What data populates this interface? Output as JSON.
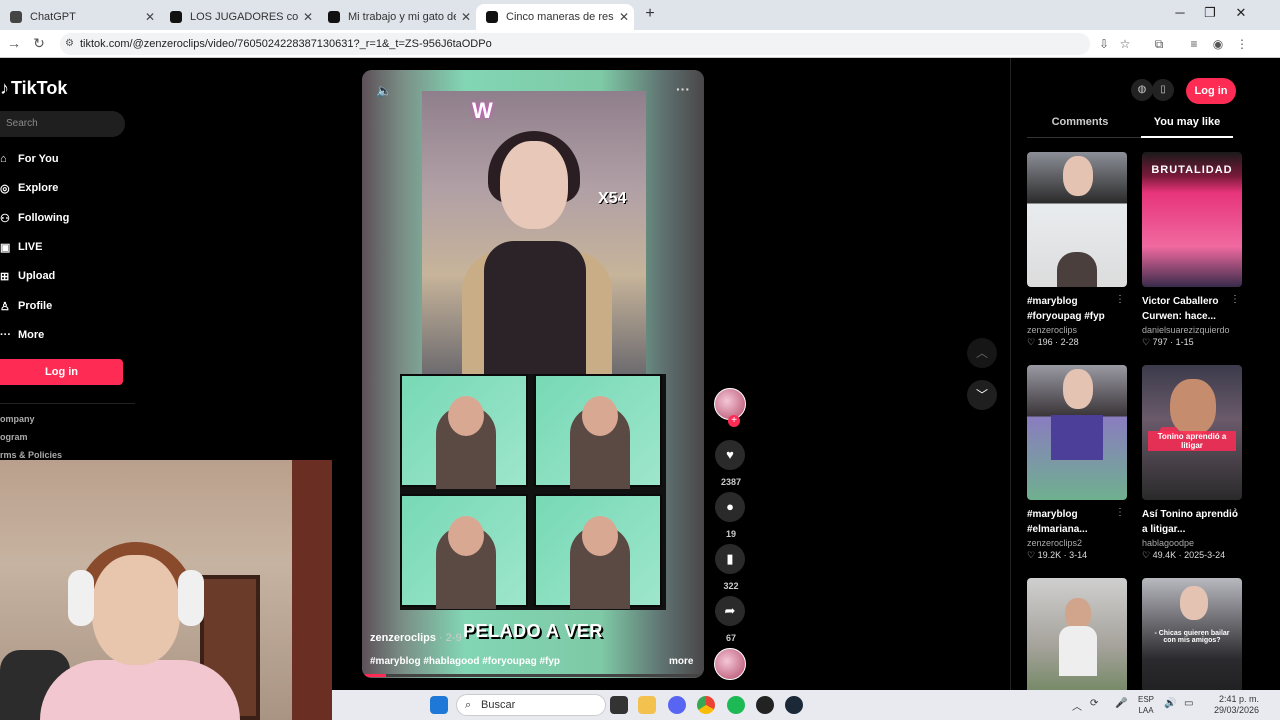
{
  "browser": {
    "tabs": [
      {
        "title": "ChatGPT",
        "active": false,
        "favicon_color": "#444444"
      },
      {
        "title": "LOS JUGADORES con MÁS RAN",
        "active": false,
        "favicon_color": "#111111"
      },
      {
        "title": "Mi trabajo y mi gato de TikTok",
        "active": false,
        "favicon_color": "#111111"
      },
      {
        "title": "Cinco maneras de resolver disc",
        "active": true,
        "favicon_color": "#111111"
      }
    ],
    "new_tab_icon": "plus-icon",
    "url": "tiktok.com/@zenzeroclips/video/7605024228387130631?_r=1&_t=ZS-956J6taODPo"
  },
  "sidebar": {
    "logo_text": "TikTok",
    "search_placeholder": "Search",
    "nav": [
      {
        "label": "For You",
        "icon": "home-icon"
      },
      {
        "label": "Explore",
        "icon": "compass-icon"
      },
      {
        "label": "Following",
        "icon": "following-icon"
      },
      {
        "label": "LIVE",
        "icon": "live-icon"
      },
      {
        "label": "Upload",
        "icon": "upload-icon"
      },
      {
        "label": "Profile",
        "icon": "profile-icon"
      },
      {
        "label": "More",
        "icon": "more-icon"
      }
    ],
    "login_label": "Log in",
    "footer": [
      "ompany",
      "ogram",
      "rms & Policies"
    ]
  },
  "video": {
    "overlay_badge": "X54",
    "caption_overlay": "PELADO A VER",
    "username": "zenzeroclips",
    "date": " · 2-9",
    "hashtags": "#maryblog #hablagood #foryoupag #fyp",
    "more_label": "more",
    "progress": 0.07
  },
  "actions": {
    "likes": "2387",
    "comments": "19",
    "saves": "322",
    "shares": "67"
  },
  "right_panel": {
    "login_label": "Log in",
    "tabs": [
      {
        "label": "Comments",
        "active": false
      },
      {
        "label": "You may like",
        "active": true
      }
    ],
    "cards": [
      {
        "title": "#maryblog #foryoupag #fyp",
        "author": "zenzeroclips",
        "stats": "♡ 196 · 2-28",
        "thumb_text": ""
      },
      {
        "title": "Victor Caballero Curwen: hace...",
        "author": "danielsuarezizquierdo",
        "stats": "♡ 797 · 1-15",
        "thumb_text": "BRUTALIDAD"
      },
      {
        "title": "#maryblog #elmariana...",
        "author": "zenzeroclips2",
        "stats": "♡ 19.2K · 3-14",
        "thumb_text": ""
      },
      {
        "title": "Así Tonino aprendió a litigar...",
        "author": "hablagoodpe",
        "stats": "♡ 49.4K · 2025-3-24",
        "thumb_text": "Tonino aprendió a litigar"
      },
      {
        "title": "",
        "author": "",
        "stats": "",
        "thumb_text": ""
      },
      {
        "title": "",
        "author": "",
        "stats": "",
        "thumb_text": "- Chicas quieren bailar con mis amigos?"
      }
    ]
  },
  "taskbar": {
    "search_placeholder": "Buscar",
    "lang_line1": "ESP",
    "lang_line2": "LAA",
    "time": "2:41 p. m.",
    "date": "29/03/2026"
  }
}
